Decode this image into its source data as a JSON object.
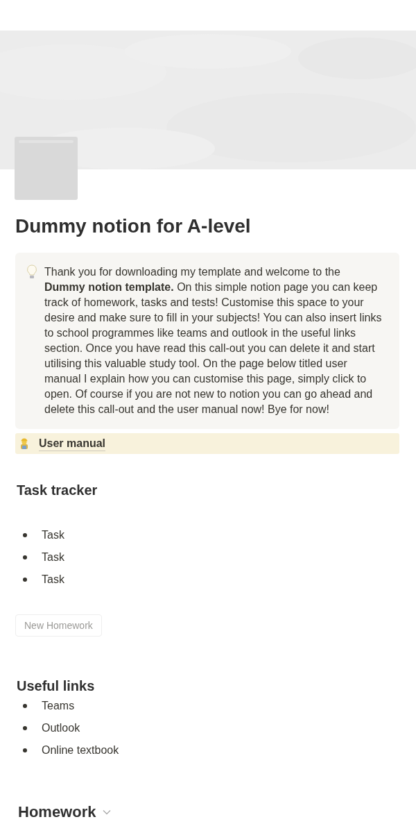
{
  "page": {
    "title": "Dummy notion for A-level"
  },
  "callout": {
    "text": "Thank you for downloading my template and welcome to the **Dummy notion template.** On this simple notion page you can keep track of homework, tasks and tests! Customise this space to your desire and make sure to fill in your subjects! You can also insert links to school programmes like teams and outlook in the useful links section. Once you have read this call-out you can delete it and start utilising this valuable study tool. On the page below titled user manual I explain how you can customise this page, simply click to open. Of course if you are not new to notion you can go ahead and delete this call-out and the user manual now! Bye for now!"
  },
  "subpage": {
    "label": "User manual"
  },
  "task_tracker": {
    "heading": "Task tracker",
    "items": [
      "Task",
      "Task",
      "Task"
    ]
  },
  "new_button": {
    "label": "New Homework"
  },
  "useful_links": {
    "heading": "Useful links",
    "items": [
      "Teams",
      "Outlook",
      "Online textbook"
    ]
  },
  "homework": {
    "heading": "Homework"
  }
}
